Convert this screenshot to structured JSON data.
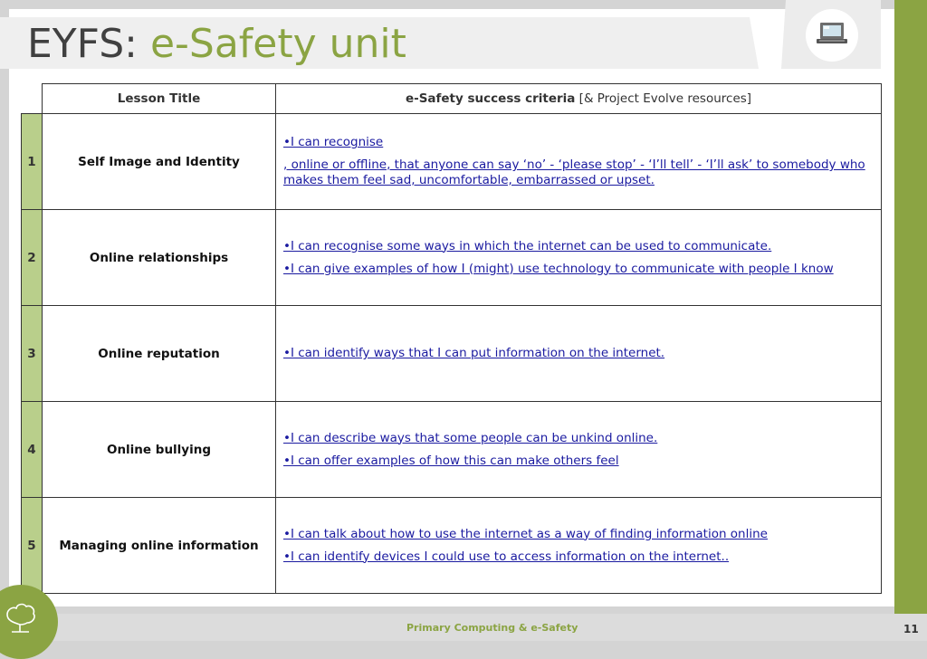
{
  "title": {
    "prefix": "EYFS:",
    "accent": "e-Safety unit"
  },
  "icons": {
    "header_icon": "laptop-icon",
    "footer_logo": "tree-logo"
  },
  "colors": {
    "accent_green": "#8ba443",
    "number_cell": "#b9cf8b",
    "link_blue": "#1a1aa0"
  },
  "table": {
    "headers": {
      "lesson_title": "Lesson Title",
      "criteria_bold": "e-Safety success criteria",
      "criteria_rest": " [& Project Evolve resources]"
    },
    "rows": [
      {
        "num": "1",
        "lesson": "Self Image and Identity",
        "lines": [
          "•I can recognise",
          ", online or offline, that anyone can say ‘no’ - ‘please stop’ - ‘I’ll tell’ - ‘I’ll ask’ to somebody who makes them feel sad, uncomfortable, embarrassed or upset."
        ]
      },
      {
        "num": "2",
        "lesson": "Online relationships",
        "lines": [
          "•I can recognise some ways in which the internet can be used to communicate.",
          "•I can give examples of how I (might) use technology to communicate with people I know"
        ]
      },
      {
        "num": "3",
        "lesson": "Online reputation",
        "lines": [
          "•I can identify ways that I can put information on the internet."
        ]
      },
      {
        "num": "4",
        "lesson": "Online bullying",
        "lines": [
          "•I can describe ways that some people can be unkind online.",
          "•I can offer examples of how this can make others feel"
        ]
      },
      {
        "num": "5",
        "lesson": "Managing online information",
        "lines": [
          "•I can talk about how to use the internet as a way of finding information online",
          "•I can identify devices I could use to access information on the internet.."
        ]
      }
    ]
  },
  "footer": {
    "text": "Primary Computing & e-Safety",
    "page": "11"
  }
}
